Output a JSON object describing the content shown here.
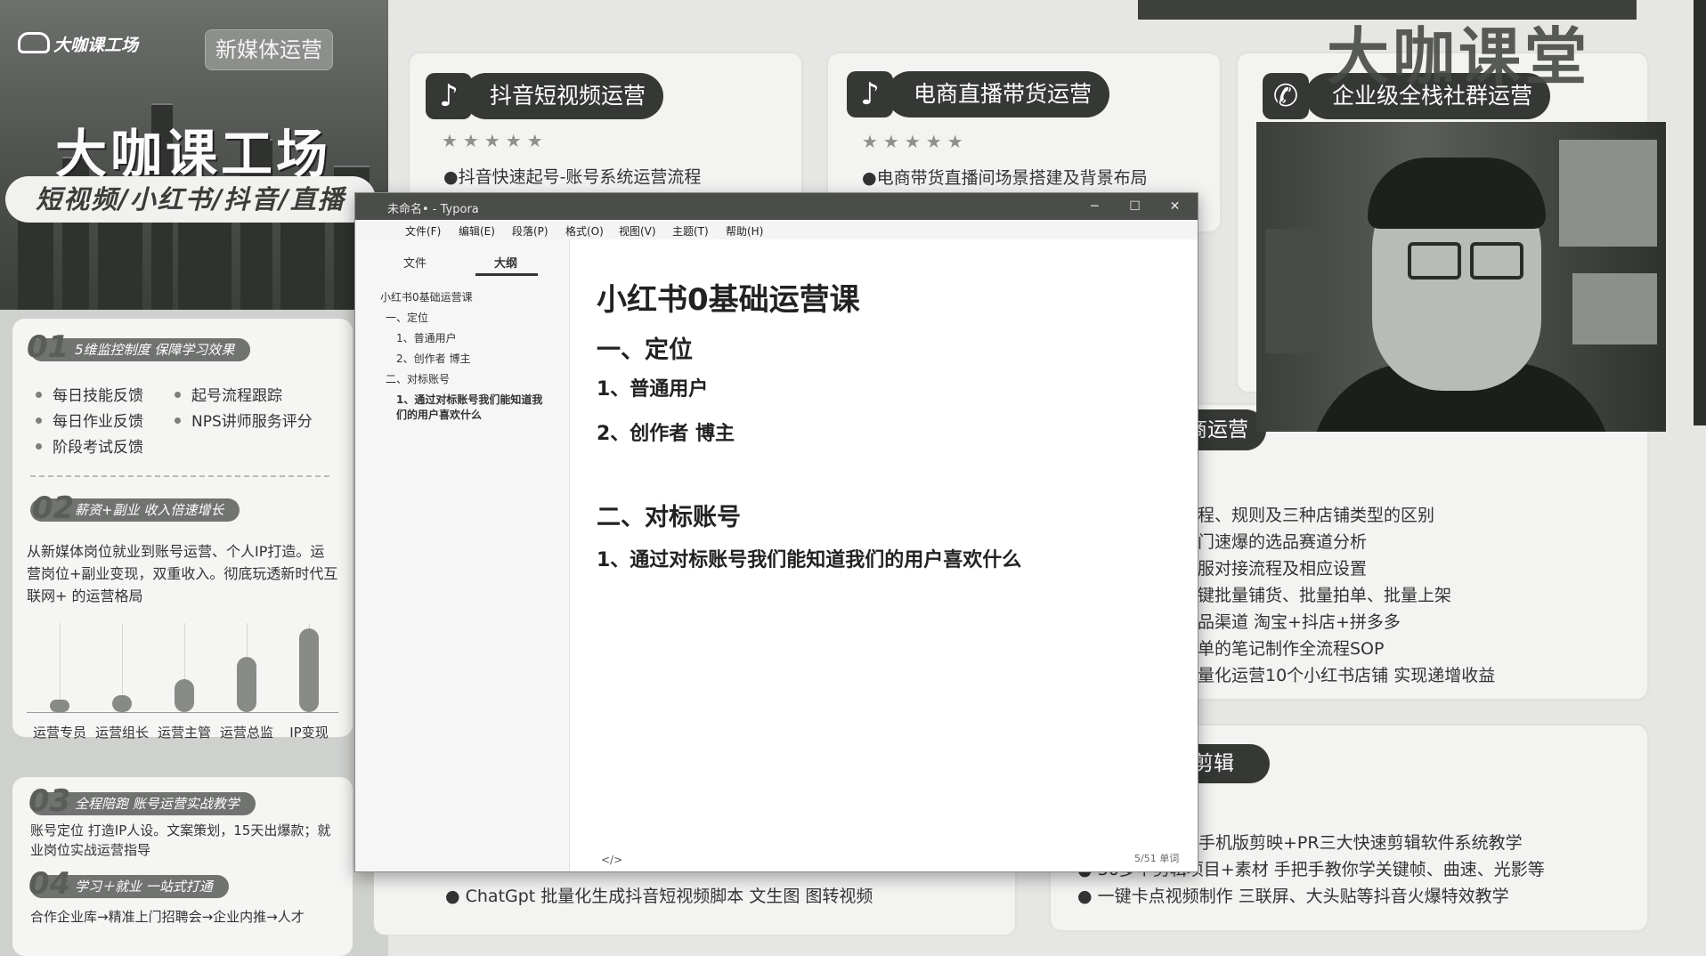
{
  "promo": {
    "logo_text": "大咖课工场",
    "tag_button": "新媒体运营",
    "banner_title": "大咖课工场",
    "banner_subtitle": "短视频/小红书/抖音/直播",
    "sections": [
      {
        "num": "01",
        "title": "5维监控制度 保障学习效果",
        "items": [
          "每日技能反馈",
          "起号流程跟踪",
          "每日作业反馈",
          "NPS讲师服务评分",
          "阶段考试反馈"
        ]
      },
      {
        "num": "02",
        "title": "薪资+副业 收入倍速增长",
        "text": "从新媒体岗位就业到账号运营、个人IP打造。运营岗位+副业变现，双重收入。彻底玩透新时代互联网+ 的运营格局"
      },
      {
        "num": "03",
        "title": "全程陪跑 账号运营实战教学",
        "text": "账号定位 打造IP人设。文案策划，15天出爆款；就业岗位实战运营指导"
      },
      {
        "num": "04",
        "title": "学习＋就业 一站式打通",
        "text": "合作企业库→精准上门招聘会→企业内推→人才"
      }
    ]
  },
  "chart_data": {
    "type": "bar",
    "categories": [
      "运营专员",
      "运营组长",
      "运营主管",
      "运营总监",
      "IP变现"
    ],
    "values": [
      1,
      1.5,
      3,
      5,
      7.5
    ],
    "ylim": [
      0,
      8
    ],
    "grid": true
  },
  "courses": [
    {
      "icon": "tiktok-icon",
      "title": "抖音短视频运营",
      "stars": "★★★★★",
      "line": "●抖音快速起号-账号系统运营流程",
      "bottom_lines": [
        "ChatGpt 批量化生成抖音短视频脚本 文生图 图转视频"
      ]
    },
    {
      "icon": "tiktok-icon",
      "title": "电商直播带货运营",
      "stars": "★★★★★",
      "line": "●电商带货直播间场景搭建及背景布局"
    },
    {
      "icon": "wechat-icon",
      "title": "企业级全栈社群运营"
    }
  ],
  "ecommerce": {
    "title": "电商运营",
    "lines": [
      "流程、规则及三种店铺类型的区别",
      "冷门速爆的选品赛道分析",
      "客服对接流程及相应设置",
      "一键批量铺货、批量拍单、批量上架",
      "选品渠道 淘宝+抖店+拼多多",
      "爆单的笔记制作全流程SOP",
      "批量化运营10个小红书店铺 实现递增收益"
    ]
  },
  "editing": {
    "title": "剪辑",
    "lines": [
      "手机版剪映+PR三大快速剪辑软件系统教学",
      "30多个剪辑项目+素材 手把手教你学关键帧、曲速、光影等",
      "一键卡点视频制作 三联屏、大头贴等抖音火爆特效教学"
    ]
  },
  "watermark": "大咖课堂",
  "typora": {
    "window_title": "未命名• - Typora",
    "menu": [
      "文件(F)",
      "编辑(E)",
      "段落(P)",
      "格式(O)",
      "视图(V)",
      "主题(T)",
      "帮助(H)"
    ],
    "sidebar_tabs": [
      "文件",
      "大纲"
    ],
    "outline": [
      "小红书0基础运营课",
      "一、定位",
      "1、普通用户",
      "2、创作者 博主",
      "二、对标账号",
      "1、通过对标账号我们能知道我们的用户喜欢什么"
    ],
    "doc": {
      "h1": "小红书0基础运营课",
      "h2_1": "一、定位",
      "item_1": "1、普通用户",
      "item_2": "2、创作者 博主",
      "h2_2": "二、对标账号",
      "item_3": "1、通过对标账号我们能知道我们的用户喜欢什么"
    },
    "status": "5/51 单词",
    "footer_left": "<",
    "footer_code": "</>"
  }
}
